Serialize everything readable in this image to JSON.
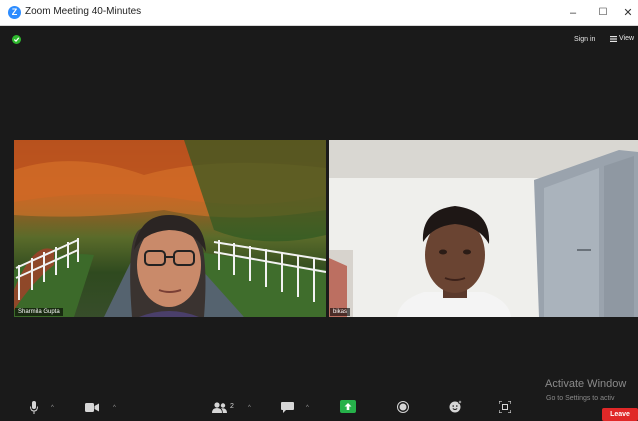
{
  "window": {
    "app_icon_glyph": "Z",
    "title": "Zoom Meeting 40-Minutes",
    "minimize_glyph": "–",
    "maximize_glyph": "☐",
    "close_glyph": "✕"
  },
  "meeting_header": {
    "sign_in": "Sign in",
    "view_label": "View",
    "security_icon": "shield-check-icon",
    "view_icon": "grid-icon"
  },
  "participants": [
    {
      "name": "Sharmila Gupta"
    },
    {
      "name": "bikas"
    }
  ],
  "toolbar": {
    "mute_icon": "microphone-icon",
    "video_icon": "video-camera-icon",
    "participants_icon": "participants-icon",
    "participants_count": "2",
    "chat_icon": "chat-icon",
    "share_icon": "share-screen-icon",
    "record_icon": "record-icon",
    "reactions_icon": "reactions-icon",
    "apps_icon": "apps-icon",
    "leave_label": "Leave"
  },
  "watermark": {
    "line1": "Activate Window",
    "line2": "Go to Settings to activ"
  },
  "colors": {
    "shield_green": "#2eb82e",
    "share_green": "#26b14a",
    "leave_red": "#e02828",
    "zoom_blue": "#2d8cff"
  }
}
